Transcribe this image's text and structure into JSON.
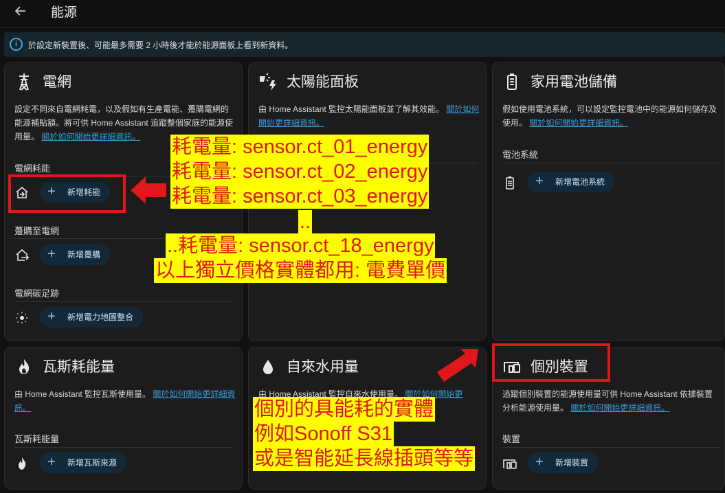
{
  "header": {
    "back_icon": "arrow-left-icon",
    "title": "能源"
  },
  "info": {
    "icon": "info-icon",
    "text": "於設定新裝置後、可能最多需要 2 小時後才能於能源面板上看到新資料。"
  },
  "grid": {
    "title": "電網",
    "desc": "設定不同來自電網耗電，以及假如有生產電能、躉購電網的能源補貼額。將可供 Home Assistant 追蹤整個家庭的能源使用量。",
    "link": "關於如何開始更詳細資訊。",
    "consumption_label": "電網耗能",
    "consumption_button": "新增耗能",
    "return_label": "躉購至電網",
    "return_button": "新增躉購",
    "co2_label": "電網碳足跡",
    "co2_button": "新增電力地圖整合"
  },
  "solar": {
    "title": "太陽能面板",
    "desc": "由 Home Assistant 監控太陽能面板並了解其效能。",
    "link": "關於如何開始更詳細資訊。"
  },
  "battery": {
    "title": "家用電池儲備",
    "desc": "假如使用電池系統，可以設定監控電池中的能源如何儲存及使用。",
    "link": "關於如何開始更詳細資訊。",
    "section_label": "電池系統",
    "button": "新增電池系統"
  },
  "gas": {
    "title": "瓦斯耗能量",
    "desc": "由 Home Assistant 監控瓦斯使用量。",
    "link": "關於如何開始更詳細資訊。",
    "section_label": "瓦斯耗能量",
    "button": "新增瓦斯來源"
  },
  "water": {
    "title": "自來水用量",
    "desc": "由 Home Assistant 監控自來水使用量。",
    "link": "關於如何開始更"
  },
  "devices": {
    "title": "個別裝置",
    "desc": "追蹤個別裝置的能源使用量可供 Home Assistant 依據裝置分析能源使用量。",
    "link": "關於如何開始更詳細資訊。",
    "section_label": "裝置",
    "button": "新增裝置"
  },
  "annotation_top": {
    "lines": [
      "耗電量: sensor.ct_01_energy",
      "耗電量: sensor.ct_02_energy",
      "耗電量: sensor.ct_03_energy",
      "..",
      "..耗電量: sensor.ct_18_energy",
      "以上獨立價格實體都用: 電費單價"
    ]
  },
  "annotation_bottom": {
    "lines": [
      "個別的具能耗的實體",
      "例如Sonoff S31",
      "或是智能延長線插頭等等"
    ]
  },
  "colors": {
    "annotation_bg": "#ffff00",
    "annotation_text": "#e0171b",
    "highlight_box": "#e0171b",
    "link": "#3a9ad9",
    "button_bg": "#13293a"
  }
}
